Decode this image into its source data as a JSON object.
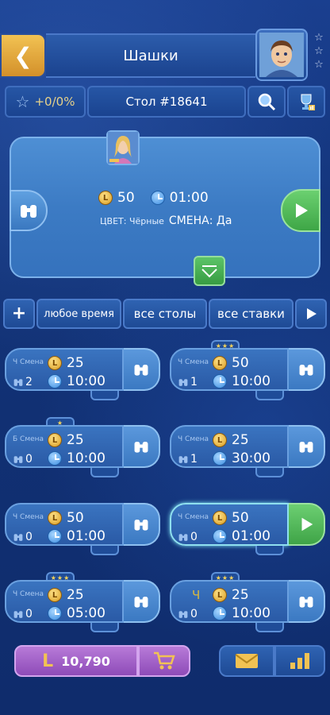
{
  "header": {
    "title": "Шашки",
    "rank_stars": 3
  },
  "infobar": {
    "rating": "+0/0%",
    "table": "Стол #18641"
  },
  "panel": {
    "stake": "50",
    "time": "01:00",
    "color_label": "ЦВЕТ: Чёрные",
    "swap_label": "СМЕНА: Да"
  },
  "filters": {
    "plus": "+",
    "time": "любое время",
    "tables": "все столы",
    "stakes": "все ставки"
  },
  "tables": [
    {
      "label": "Ч Смена",
      "stake": "25",
      "watchers": "2",
      "time": "10:00",
      "stars": "",
      "action": "watch"
    },
    {
      "label": "Ч Смена",
      "stake": "50",
      "watchers": "1",
      "time": "10:00",
      "stars": "★★★",
      "action": "watch"
    },
    {
      "label": "Б Смена",
      "stake": "25",
      "watchers": "0",
      "time": "10:00",
      "stars": "★",
      "action": "watch"
    },
    {
      "label": "Ч Смена",
      "stake": "25",
      "watchers": "1",
      "time": "30:00",
      "stars": "",
      "action": "watch"
    },
    {
      "label": "Ч Смена",
      "stake": "50",
      "watchers": "0",
      "time": "01:00",
      "stars": "",
      "action": "watch"
    },
    {
      "label": "Ч Смена",
      "stake": "50",
      "watchers": "0",
      "time": "01:00",
      "stars": "",
      "action": "play"
    },
    {
      "label": "Ч Смена",
      "stake": "25",
      "watchers": "0",
      "time": "05:00",
      "stars": "★★★",
      "action": "watch"
    },
    {
      "label": "Ч",
      "stake": "25",
      "watchers": "0",
      "time": "10:00",
      "stars": "★★★",
      "action": "watch"
    }
  ],
  "footer": {
    "balance": "10,790"
  },
  "colors": {
    "accent_gold": "#f2c253",
    "play_green": "#4fb85a",
    "shop_purple": "#9b5bc6"
  }
}
